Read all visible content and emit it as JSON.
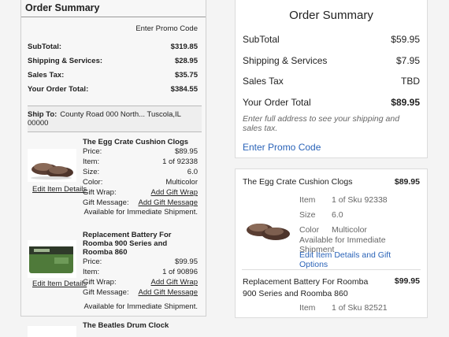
{
  "left": {
    "title": "Order Summary",
    "promo_link": "Enter Promo Code",
    "totals": [
      {
        "label": "SubTotal:",
        "value": "$319.85"
      },
      {
        "label": "Shipping & Services:",
        "value": "$28.95"
      },
      {
        "label": "Sales Tax:",
        "value": "$35.75"
      },
      {
        "label": "Your Order Total:",
        "value": "$384.55"
      }
    ],
    "ship_to_label": "Ship To:",
    "ship_to_value": "County Road 000 North... Tuscola,IL 00000",
    "items": [
      {
        "title": "The Egg Crate Cushion Clogs",
        "price_label": "Price:",
        "price": "$89.95",
        "item_label": "Item:",
        "item": "1 of 92338",
        "size_label": "Size:",
        "size": "6.0",
        "color_label": "Color:",
        "color": "Multicolor",
        "wrap_label": "Gift Wrap:",
        "wrap_link": "Add Gift Wrap",
        "msg_label": "Gift Message:",
        "msg_link": "Add Gift Message",
        "availability": "Available for Immediate Shipment.",
        "edit_link": "Edit Item Details"
      },
      {
        "title": "Replacement Battery For Roomba 900 Series and Roomba 860",
        "price_label": "Price:",
        "price": "$99.95",
        "item_label": "Item:",
        "item": "1 of 90896",
        "wrap_label": "Gift Wrap:",
        "wrap_link": "Add Gift Wrap",
        "msg_label": "Gift Message:",
        "msg_link": "Add Gift Message",
        "availability": "Available for Immediate Shipment.",
        "edit_link": "Edit Item Details"
      },
      {
        "title": "The Beatles Drum Clock"
      }
    ]
  },
  "right": {
    "title": "Order Summary",
    "totals": [
      {
        "label": "SubTotal",
        "value": "$59.95"
      },
      {
        "label": "Shipping & Services",
        "value": "$7.95"
      },
      {
        "label": "Sales Tax",
        "value": "TBD"
      },
      {
        "label": "Your Order Total",
        "value": "$89.95"
      }
    ],
    "note": "Enter full address to see your shipping and sales tax.",
    "promo_link": "Enter Promo Code",
    "items": [
      {
        "title": "The Egg Crate Cushion Clogs",
        "price": "$89.95",
        "item_label": "Item",
        "item": "1 of Sku 92338",
        "size_label": "Size",
        "size": "6.0",
        "color_label": "Color",
        "color": "Multicolor",
        "availability": "Available for Immediate Shipment",
        "edit_link": "Edit Item Details and Gift Options"
      },
      {
        "title": "Replacement Battery For Roomba 900 Series and Roomba 860",
        "price": "$99.95",
        "item_label": "Item",
        "item": "1 of Sku 82521"
      }
    ]
  }
}
